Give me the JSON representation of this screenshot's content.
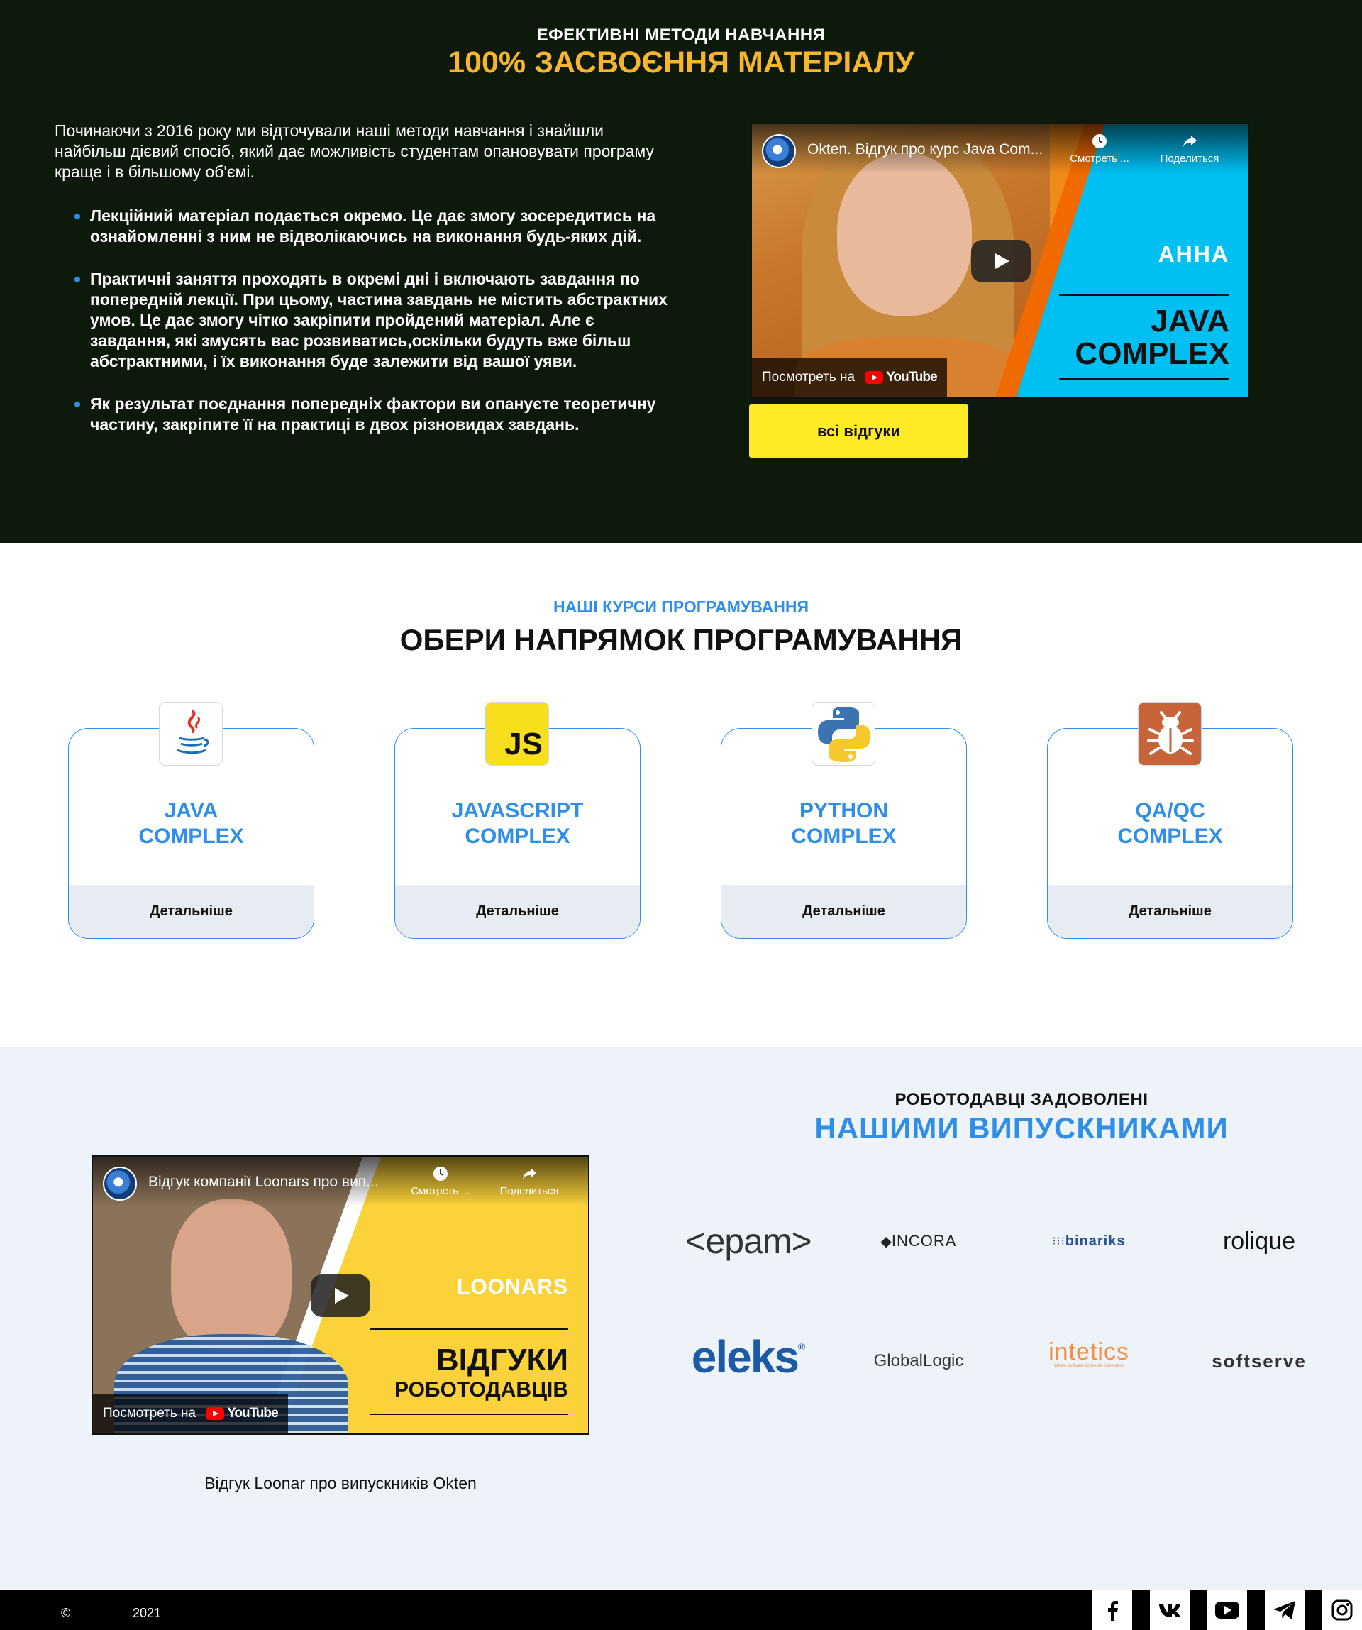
{
  "hero": {
    "kicker": "ЕФЕКТИВНІ МЕТОДИ НАВЧАННЯ",
    "title": "100% ЗАСВОЄННЯ МАТЕРІАЛУ",
    "intro": "Починаючи з 2016 року ми відточували наші методи навчання і знайшли найбільш дієвий спосіб, який дає можливість студентам опановувати програму краще і в більшому об'ємі.",
    "points": [
      "Лекційний матеріал подається окремо. Це дає змогу зосередитись на ознайомленні з ним не відволікаючись на виконання будь-яких дій.",
      "Практичні заняття проходять в окремі дні і включають завдання по попередній лекції. При цьому, частина завдань не містить абстрактних умов. Це дає змогу чітко закріпити пройдений матеріал. Але є завдання, які змусять вас розвиватись,оскільки будуть вже більш абстрактними, і їх виконання буде залежити від вашої уяви.",
      "Як результат поєднання попередніх фактори ви опануєте теоретичну частину, закріпите її на практиці в двох різновидах завдань."
    ],
    "video": {
      "title": "Okten. Відгук про курс Java Com...",
      "watch_later": "Смотреть ...",
      "share": "Поделиться",
      "watch_on": "Посмотреть на",
      "youtube": "YouTube",
      "name": "АННА",
      "course_line1": "JAVA",
      "course_line2": "COMPLEX"
    },
    "all_reviews_label": "всі відгуки"
  },
  "courses": {
    "kicker": "НАШІ КУРСИ ПРОГРАМУВАННЯ",
    "title": "ОБЕРИ НАПРЯМОК ПРОГРАМУВАННЯ",
    "items": [
      {
        "line1": "JAVA",
        "line2": "COMPLEX",
        "more": "Детальніше",
        "icon": "java-icon"
      },
      {
        "line1": "JAVASCRIPT",
        "line2": "COMPLEX",
        "more": "Детальніше",
        "icon": "js-icon",
        "icon_text": "JS"
      },
      {
        "line1": "PYTHON",
        "line2": "COMPLEX",
        "more": "Детальніше",
        "icon": "python-icon"
      },
      {
        "line1": "QA/QC",
        "line2": "COMPLEX",
        "more": "Детальніше",
        "icon": "bug-icon"
      }
    ],
    "accent": "#2f8fe8"
  },
  "employers": {
    "kicker": "РОБОТОДАВЦІ ЗАДОВОЛЕНІ",
    "title": "НАШИМИ ВИПУСКНИКАМИ",
    "video": {
      "title": "Відгук компанії Loonars про вип...",
      "watch_later": "Смотреть ...",
      "share": "Поделиться",
      "watch_on": "Посмотреть на",
      "youtube": "YouTube",
      "company": "LOONARS",
      "line1": "ВІДГУКИ",
      "line2": "РОБОТОДАВЦІВ"
    },
    "caption": "Відгук Loonar про випускників Okten",
    "logos": [
      "<epam>",
      "INCORA",
      "binariks",
      "rolique",
      "eleks",
      "GlobalLogic",
      "intetics",
      "softserve"
    ],
    "intetics_tagline": "Where software concepts come alive"
  },
  "footer": {
    "copyright": "©",
    "year": "2021",
    "social": [
      "facebook-icon",
      "vk-icon",
      "youtube-icon",
      "telegram-icon",
      "instagram-icon"
    ]
  },
  "colors": {
    "hero_bg": "#0d1a0b",
    "hero_title": "#f7b52d",
    "button": "#ffea26",
    "section_bg": "#eef3fa"
  }
}
